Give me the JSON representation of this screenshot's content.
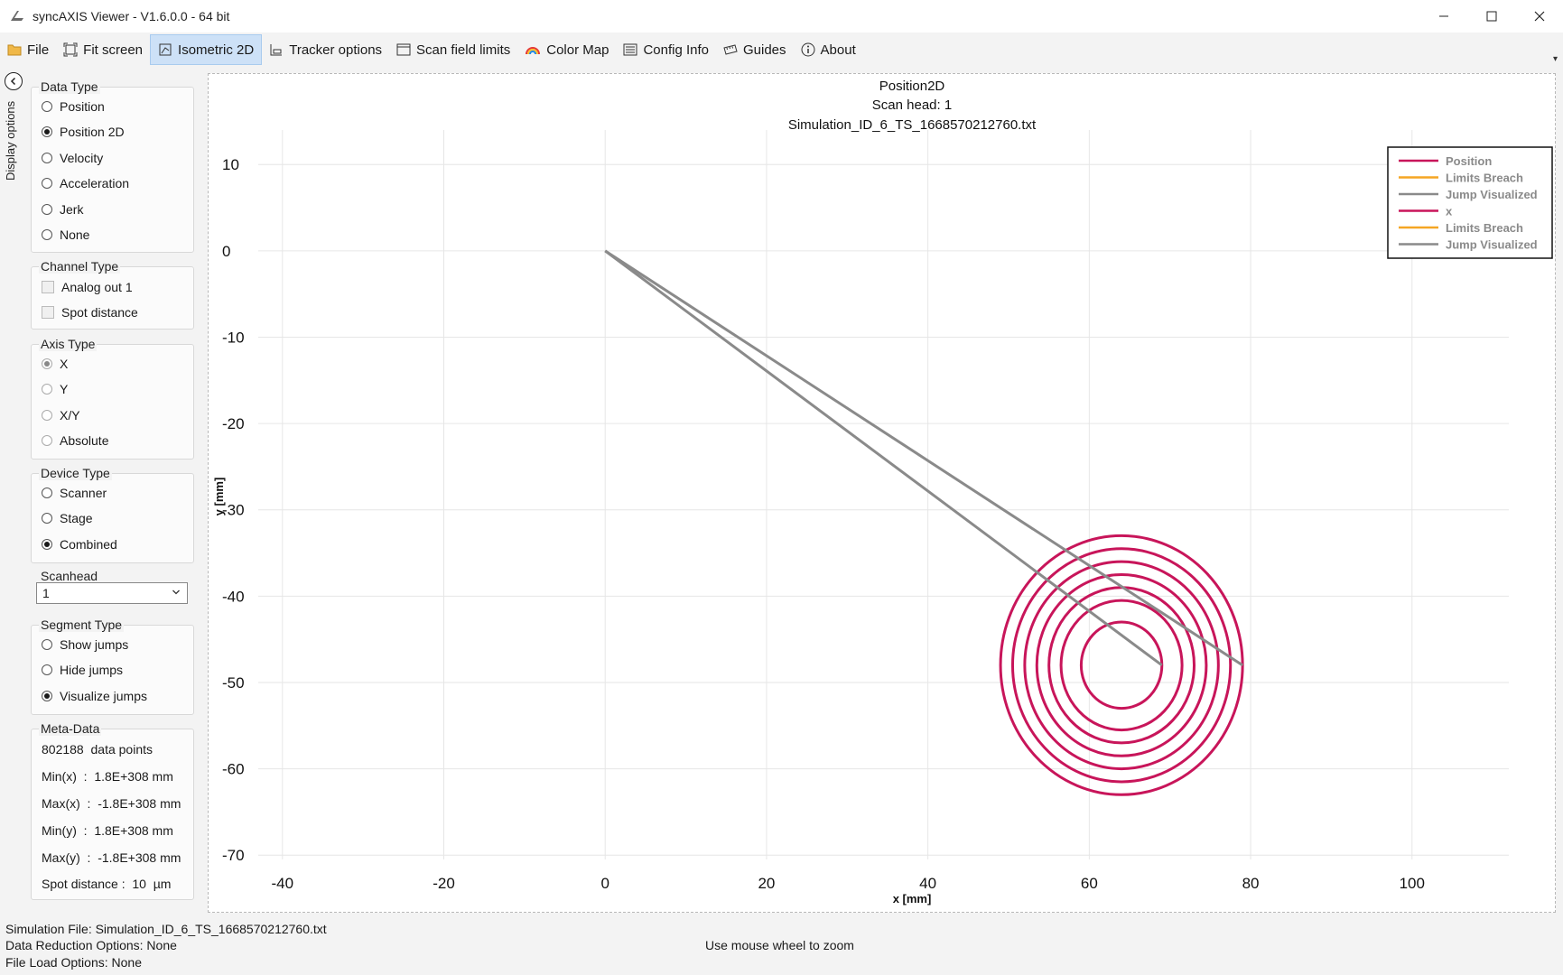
{
  "window": {
    "title": "syncAXIS Viewer - V1.6.0.0 - 64 bit",
    "minimize_icon": "minimize-icon",
    "maximize_icon": "maximize-icon",
    "close_icon": "close-icon"
  },
  "toolbar": {
    "items": [
      {
        "label": "File",
        "icon": "folder-icon"
      },
      {
        "label": "Fit screen",
        "icon": "fit-screen-icon"
      },
      {
        "label": "Isometric 2D",
        "icon": "isometric-icon",
        "active": true
      },
      {
        "label": "Tracker options",
        "icon": "tracker-icon"
      },
      {
        "label": "Scan field limits",
        "icon": "scan-field-icon"
      },
      {
        "label": "Color Map",
        "icon": "rainbow-icon"
      },
      {
        "label": "Config Info",
        "icon": "list-icon"
      },
      {
        "label": "Guides",
        "icon": "ruler-icon"
      },
      {
        "label": "About",
        "icon": "info-icon"
      }
    ]
  },
  "side": {
    "collapse_label": "Display options",
    "data_type": {
      "title": "Data Type",
      "options": [
        "Position",
        "Position 2D",
        "Velocity",
        "Acceleration",
        "Jerk",
        "None"
      ],
      "selected": "Position 2D"
    },
    "channel_type": {
      "title": "Channel Type",
      "options": [
        "Analog out 1",
        "Spot distance"
      ]
    },
    "axis_type": {
      "title": "Axis Type",
      "options": [
        "X",
        "Y",
        "X/Y",
        "Absolute"
      ],
      "selected": "X"
    },
    "device_type": {
      "title": "Device Type",
      "options": [
        "Scanner",
        "Stage",
        "Combined"
      ],
      "selected": "Combined"
    },
    "scanhead": {
      "title": "Scanhead",
      "value": "1"
    },
    "segment_type": {
      "title": "Segment Type",
      "options": [
        "Show jumps",
        "Hide jumps",
        "Visualize jumps"
      ],
      "selected": "Visualize jumps"
    },
    "meta": {
      "title": "Meta-Data",
      "rows": [
        "802188  data points",
        "Min(x)  :  1.8E+308 mm",
        "Max(x)  :  -1.8E+308 mm",
        "Min(y)  :  1.8E+308 mm",
        "Max(y)  :  -1.8E+308 mm",
        "Spot distance :  10  µm"
      ]
    }
  },
  "chart_data": {
    "type": "line",
    "title": "Position2D",
    "subtitle": [
      "Scan head: 1",
      "Simulation_ID_6_TS_1668570212760.txt"
    ],
    "xlabel": "x [mm]",
    "ylabel": "y [mm]",
    "xlim": [
      -43,
      112
    ],
    "ylim": [
      -70.5,
      14
    ],
    "xticks": [
      -40,
      -20,
      0,
      20,
      40,
      60,
      80,
      100
    ],
    "yticks": [
      10,
      0,
      -10,
      -20,
      -30,
      -40,
      -50,
      -60,
      -70
    ],
    "grid": true,
    "legend_position": "top-right",
    "legend": [
      {
        "name": "Position",
        "color": "#c8155a"
      },
      {
        "name": "Limits Breach",
        "color": "#f5a623"
      },
      {
        "name": "Jump Visualized",
        "color": "#8a8a8a"
      },
      {
        "name": "x",
        "color": "#c8155a"
      },
      {
        "name": "Limits Breach",
        "color": "#f5a623"
      },
      {
        "name": "Jump Visualized",
        "color": "#8a8a8a"
      }
    ],
    "series": [
      {
        "name": "Position",
        "shape": "concentric circles",
        "center": [
          64,
          -48
        ],
        "radii": [
          5,
          7.5,
          9,
          10.5,
          12,
          13.5,
          15
        ],
        "color": "#c8155a"
      },
      {
        "name": "Jump Visualized",
        "color": "#8a8a8a",
        "segments": [
          [
            [
              0,
              0
            ],
            [
              79,
              -48
            ]
          ],
          [
            [
              0,
              0
            ],
            [
              69,
              -48
            ]
          ]
        ]
      }
    ]
  },
  "status": {
    "simulation_file": "Simulation File: Simulation_ID_6_TS_1668570212760.txt",
    "data_reduction": "Data Reduction Options: None",
    "file_load": "File Load Options:  None",
    "hint": "Use mouse wheel to zoom"
  }
}
